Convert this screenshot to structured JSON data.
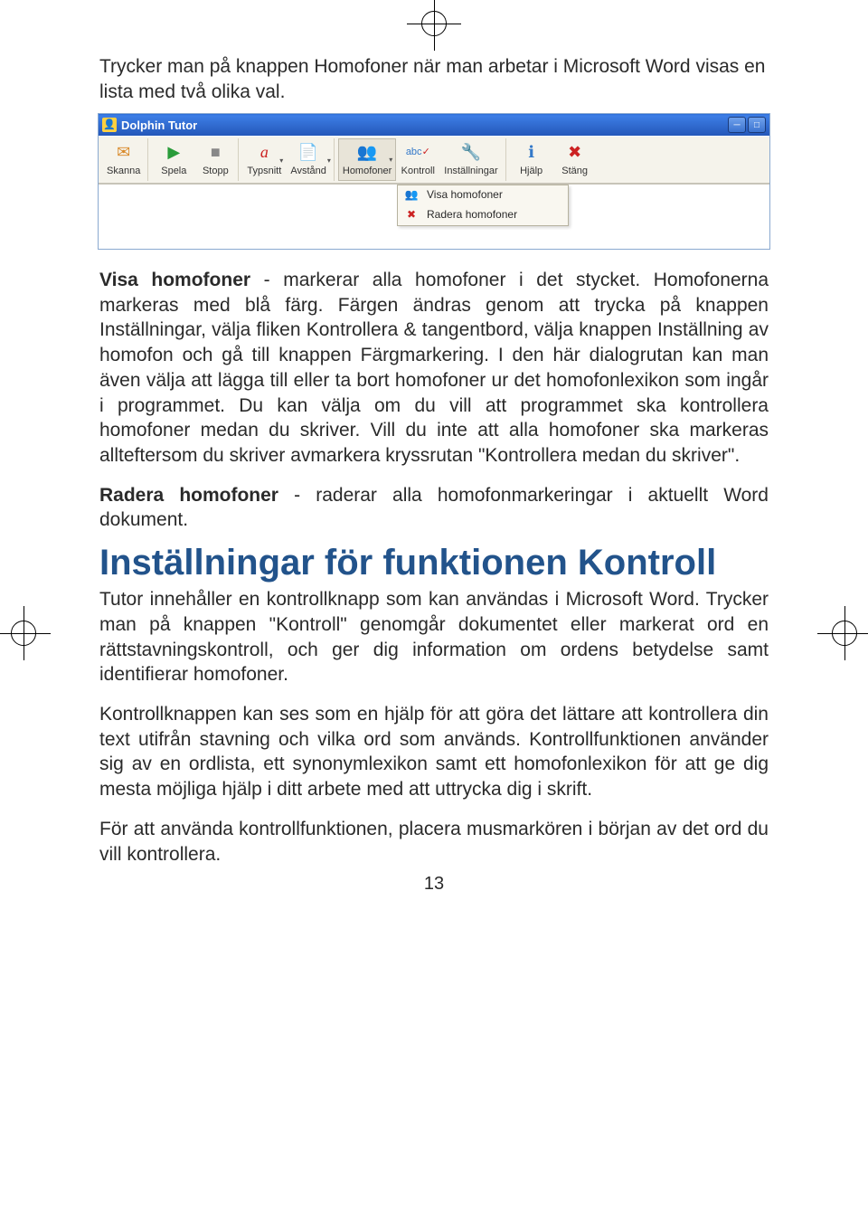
{
  "intro": "Trycker man på knappen Homofoner när man arbetar i Microsoft Word visas en lista med två olika val.",
  "window": {
    "title": "Dolphin Tutor",
    "toolbar": {
      "skanna": "Skanna",
      "spela": "Spela",
      "stopp": "Stopp",
      "typsnitt": "Typsnitt",
      "avstand": "Avstånd",
      "homofoner": "Homofoner",
      "kontroll": "Kontroll",
      "installningar": "Inställningar",
      "hjalp": "Hjälp",
      "stang": "Stäng"
    },
    "dropdown": {
      "visa": "Visa homofoner",
      "radera": "Radera homofoner"
    }
  },
  "para_visa": "Visa homofoner - markerar alla homofoner i det stycket. Homofonerna markeras med blå färg. Färgen ändras genom att trycka på knappen Inställningar, välja fliken Kontrollera & tangentbord, välja knappen Inställning av homofon och gå till knappen Färgmarkering. I den här dialogrutan kan man även välja att lägga till eller ta bort homofoner ur det homofonlexikon som ingår i programmet. Du kan välja om du vill att programmet ska kontrollera homofoner medan du skriver. Vill du inte att alla homofoner ska markeras allteftersom du skriver avmarkera kryssrutan \"Kontrollera medan du skriver\".",
  "para_visa_bold": "Visa homofoner",
  "para_radera": "Radera homofoner - raderar alla homofonmarkeringar i aktuellt Word dokument.",
  "para_radera_bold": "Radera homofoner",
  "heading": "Inställningar för funktionen Kontroll",
  "para_tutor": "Tutor innehåller en kontrollknapp som kan användas i Microsoft Word. Trycker man på knappen \"Kontroll\" genomgår dokumentet eller markerat ord en rättstavningskontroll, och ger dig information om ordens betydelse samt identifierar homofoner.",
  "para_kontroll": "Kontrollknappen kan ses som en hjälp för att göra det lättare att kontrollera din text utifrån stavning och vilka ord som används. Kontrollfunktionen använder sig av en ordlista, ett synonymlexikon samt ett homofonlexikon för att ge dig mesta möjliga hjälp i ditt arbete med att uttrycka dig i skrift.",
  "para_anvand": "För att använda kontrollfunktionen, placera musmarkören i början av det ord du vill kontrollera.",
  "page_number": "13"
}
